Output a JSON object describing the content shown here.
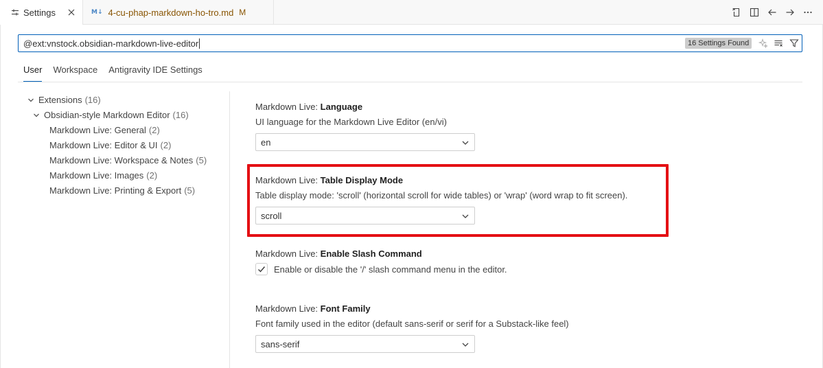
{
  "tabs": {
    "settings": {
      "label": "Settings",
      "icon": "settings-sliders-icon"
    },
    "file": {
      "badge": "M↓",
      "label": "4-cu-phap-markdown-ho-tro.md",
      "modified": "M"
    }
  },
  "search": {
    "value": "@ext:vnstock.obsidian-markdown-live-editor",
    "results_badge": "16 Settings Found"
  },
  "scope_tabs": [
    "User",
    "Workspace",
    "Antigravity IDE Settings"
  ],
  "toc": {
    "root": {
      "label": "Extensions",
      "count": "(16)"
    },
    "group": {
      "label": "Obsidian-style Markdown Editor",
      "count": "(16)"
    },
    "items": [
      {
        "label": "Markdown Live: General",
        "count": "(2)"
      },
      {
        "label": "Markdown Live: Editor & UI",
        "count": "(2)"
      },
      {
        "label": "Markdown Live: Workspace & Notes",
        "count": "(5)"
      },
      {
        "label": "Markdown Live: Images",
        "count": "(2)"
      },
      {
        "label": "Markdown Live: Printing & Export",
        "count": "(5)"
      }
    ]
  },
  "settings": {
    "language": {
      "category": "Markdown Live: ",
      "name": "Language",
      "description": "UI language for the Markdown Live Editor (en/vi)",
      "value": "en"
    },
    "table_mode": {
      "category": "Markdown Live: ",
      "name": "Table Display Mode",
      "description": "Table display mode: 'scroll' (horizontal scroll for wide tables) or 'wrap' (word wrap to fit screen).",
      "value": "scroll"
    },
    "slash_command": {
      "category": "Markdown Live: ",
      "name": "Enable Slash Command",
      "description": "Enable or disable the '/' slash command menu in the editor.",
      "checked": true
    },
    "font_family": {
      "category": "Markdown Live: ",
      "name": "Font Family",
      "description": "Font family used in the editor (default sans-serif or serif for a Substack-like feel)",
      "value": "sans-serif"
    }
  },
  "colors": {
    "accent": "#005fb8",
    "highlight_border": "#e40f14",
    "modified_text": "#895503"
  }
}
